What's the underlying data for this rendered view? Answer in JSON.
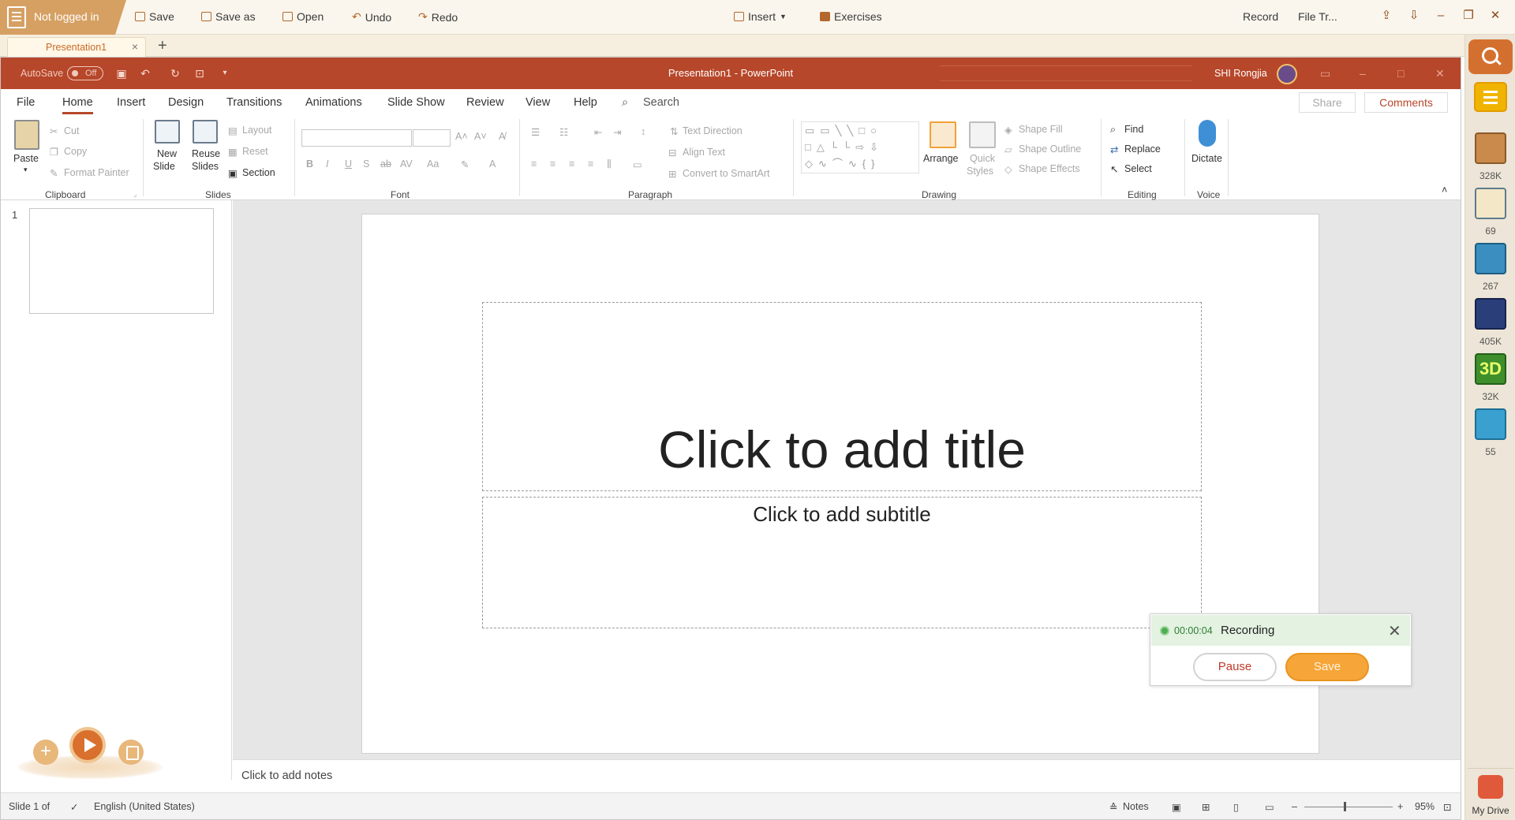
{
  "topbar": {
    "login_status": "Not logged in",
    "save": "Save",
    "save_as": "Save as",
    "open": "Open",
    "undo": "Undo",
    "redo": "Redo",
    "insert": "Insert",
    "exercises": "Exercises",
    "record": "Record",
    "file_transfer": "File Tr..."
  },
  "tabs": {
    "doc_tab": "Presentation1",
    "new_tab": "+"
  },
  "titlebar": {
    "autosave_label": "AutoSave",
    "autosave_state": "Off",
    "title": "Presentation1  -  PowerPoint",
    "user": "SHI Rongjia"
  },
  "ribbon_tabs": [
    "File",
    "Home",
    "Insert",
    "Design",
    "Transitions",
    "Animations",
    "Slide Show",
    "Review",
    "View",
    "Help"
  ],
  "search_label": "Search",
  "share": "Share",
  "comments": "Comments",
  "ribbon": {
    "clipboard": {
      "paste": "Paste",
      "cut": "Cut",
      "copy": "Copy",
      "format_painter": "Format Painter",
      "group": "Clipboard"
    },
    "slides": {
      "new_slide_1": "New",
      "new_slide_2": "Slide",
      "reuse_1": "Reuse",
      "reuse_2": "Slides",
      "layout": "Layout",
      "reset": "Reset",
      "section": "Section",
      "group": "Slides"
    },
    "font": {
      "group": "Font"
    },
    "paragraph": {
      "text_direction": "Text Direction",
      "align_text": "Align Text",
      "convert": "Convert to SmartArt",
      "group": "Paragraph"
    },
    "drawing": {
      "arrange": "Arrange",
      "quick_1": "Quick",
      "quick_2": "Styles",
      "shape_fill": "Shape Fill",
      "shape_outline": "Shape Outline",
      "shape_effects": "Shape Effects",
      "group": "Drawing"
    },
    "editing": {
      "find": "Find",
      "replace": "Replace",
      "select": "Select",
      "group": "Editing"
    },
    "voice": {
      "dictate": "Dictate",
      "group": "Voice"
    }
  },
  "thumbs": {
    "slide_number": "1"
  },
  "slide": {
    "title_placeholder": "Click to add title",
    "subtitle_placeholder": "Click to add subtitle"
  },
  "recording": {
    "time": "00:00:04",
    "label": "Recording",
    "pause": "Pause",
    "save": "Save"
  },
  "notes_placeholder": "Click to add notes",
  "status": {
    "slide": "Slide 1 of",
    "language": "English (United States)",
    "notes": "Notes",
    "zoom": "95%"
  },
  "sidebar": {
    "counts": [
      "328K",
      "69",
      "267",
      "405K",
      "32K",
      "55"
    ],
    "drive": "My Drive"
  },
  "colors": {
    "accent": "#b7472a",
    "brand": "#d6a063",
    "record_green": "#4caf50",
    "save_orange": "#f6a538"
  }
}
